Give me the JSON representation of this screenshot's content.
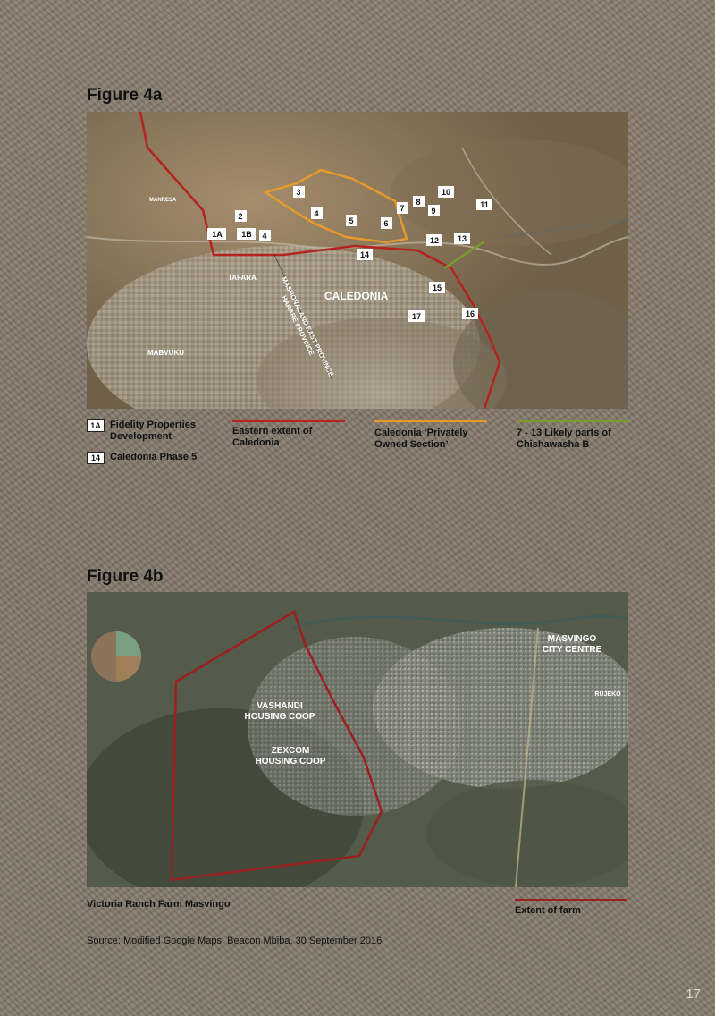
{
  "figure_a": {
    "title": "Figure 4a",
    "map_labels": {
      "mabvuku": "MABVUKU",
      "tafara": "TAFARA",
      "caledonia": "CALEDONIA",
      "manresa": "MANRESA",
      "boundary_east": "MASHONALAND EAST PROVINCE",
      "boundary_harare": "HARARE PROVINCE"
    },
    "markers": [
      "1A",
      "1B",
      "2",
      "3",
      "4",
      "4",
      "5",
      "6",
      "7",
      "8",
      "9",
      "10",
      "11",
      "12",
      "13",
      "14",
      "15",
      "16",
      "17"
    ],
    "legend": {
      "box_1a": "1A",
      "item_1a": "Fidelity Properties Development",
      "box_14": "14",
      "item_14": "Caledonia Phase 5",
      "eastern_extent": "Eastern extent of Caledonia",
      "private_section": "Caledonia ‘Privately Owned Section’",
      "chishawasha": "7 - 13 Likely parts of Chishawasha B"
    },
    "colors": {
      "eastern_extent": "#b4231f",
      "private_section": "#e59a2c",
      "chishawasha": "#7a9a2a"
    }
  },
  "figure_b": {
    "title": "Figure 4b",
    "map_labels": {
      "vashandi": "VASHANDI HOUSING COOP",
      "zexcom": "ZEXCOM HOUSING COOP",
      "masvingo": "MASVINGO CITY CENTRE",
      "rujeko": "RUJEKO"
    },
    "caption": "Victoria Ranch Farm Masvingo",
    "legend": {
      "extent": "Extent of farm"
    },
    "colors": {
      "extent": "#9b1f1f"
    }
  },
  "source": "Source: Modified Google Maps. Beacon Mbiba, 30 September 2016",
  "page_number": "17"
}
